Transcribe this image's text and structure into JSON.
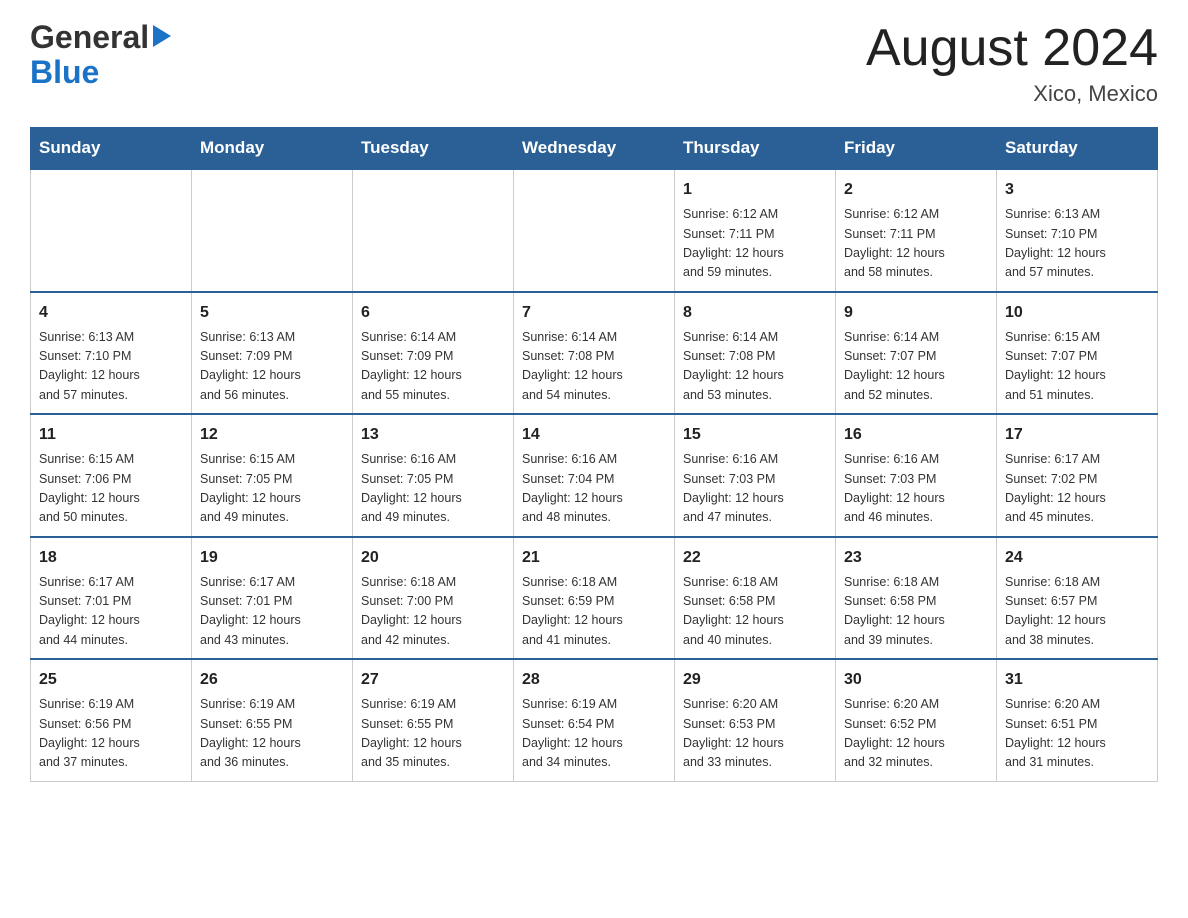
{
  "header": {
    "logo_line1": "General",
    "logo_line2": "Blue",
    "month_title": "August 2024",
    "location": "Xico, Mexico"
  },
  "weekdays": [
    "Sunday",
    "Monday",
    "Tuesday",
    "Wednesday",
    "Thursday",
    "Friday",
    "Saturday"
  ],
  "weeks": [
    {
      "days": [
        {
          "num": "",
          "info": ""
        },
        {
          "num": "",
          "info": ""
        },
        {
          "num": "",
          "info": ""
        },
        {
          "num": "",
          "info": ""
        },
        {
          "num": "1",
          "info": "Sunrise: 6:12 AM\nSunset: 7:11 PM\nDaylight: 12 hours\nand 59 minutes."
        },
        {
          "num": "2",
          "info": "Sunrise: 6:12 AM\nSunset: 7:11 PM\nDaylight: 12 hours\nand 58 minutes."
        },
        {
          "num": "3",
          "info": "Sunrise: 6:13 AM\nSunset: 7:10 PM\nDaylight: 12 hours\nand 57 minutes."
        }
      ]
    },
    {
      "days": [
        {
          "num": "4",
          "info": "Sunrise: 6:13 AM\nSunset: 7:10 PM\nDaylight: 12 hours\nand 57 minutes."
        },
        {
          "num": "5",
          "info": "Sunrise: 6:13 AM\nSunset: 7:09 PM\nDaylight: 12 hours\nand 56 minutes."
        },
        {
          "num": "6",
          "info": "Sunrise: 6:14 AM\nSunset: 7:09 PM\nDaylight: 12 hours\nand 55 minutes."
        },
        {
          "num": "7",
          "info": "Sunrise: 6:14 AM\nSunset: 7:08 PM\nDaylight: 12 hours\nand 54 minutes."
        },
        {
          "num": "8",
          "info": "Sunrise: 6:14 AM\nSunset: 7:08 PM\nDaylight: 12 hours\nand 53 minutes."
        },
        {
          "num": "9",
          "info": "Sunrise: 6:14 AM\nSunset: 7:07 PM\nDaylight: 12 hours\nand 52 minutes."
        },
        {
          "num": "10",
          "info": "Sunrise: 6:15 AM\nSunset: 7:07 PM\nDaylight: 12 hours\nand 51 minutes."
        }
      ]
    },
    {
      "days": [
        {
          "num": "11",
          "info": "Sunrise: 6:15 AM\nSunset: 7:06 PM\nDaylight: 12 hours\nand 50 minutes."
        },
        {
          "num": "12",
          "info": "Sunrise: 6:15 AM\nSunset: 7:05 PM\nDaylight: 12 hours\nand 49 minutes."
        },
        {
          "num": "13",
          "info": "Sunrise: 6:16 AM\nSunset: 7:05 PM\nDaylight: 12 hours\nand 49 minutes."
        },
        {
          "num": "14",
          "info": "Sunrise: 6:16 AM\nSunset: 7:04 PM\nDaylight: 12 hours\nand 48 minutes."
        },
        {
          "num": "15",
          "info": "Sunrise: 6:16 AM\nSunset: 7:03 PM\nDaylight: 12 hours\nand 47 minutes."
        },
        {
          "num": "16",
          "info": "Sunrise: 6:16 AM\nSunset: 7:03 PM\nDaylight: 12 hours\nand 46 minutes."
        },
        {
          "num": "17",
          "info": "Sunrise: 6:17 AM\nSunset: 7:02 PM\nDaylight: 12 hours\nand 45 minutes."
        }
      ]
    },
    {
      "days": [
        {
          "num": "18",
          "info": "Sunrise: 6:17 AM\nSunset: 7:01 PM\nDaylight: 12 hours\nand 44 minutes."
        },
        {
          "num": "19",
          "info": "Sunrise: 6:17 AM\nSunset: 7:01 PM\nDaylight: 12 hours\nand 43 minutes."
        },
        {
          "num": "20",
          "info": "Sunrise: 6:18 AM\nSunset: 7:00 PM\nDaylight: 12 hours\nand 42 minutes."
        },
        {
          "num": "21",
          "info": "Sunrise: 6:18 AM\nSunset: 6:59 PM\nDaylight: 12 hours\nand 41 minutes."
        },
        {
          "num": "22",
          "info": "Sunrise: 6:18 AM\nSunset: 6:58 PM\nDaylight: 12 hours\nand 40 minutes."
        },
        {
          "num": "23",
          "info": "Sunrise: 6:18 AM\nSunset: 6:58 PM\nDaylight: 12 hours\nand 39 minutes."
        },
        {
          "num": "24",
          "info": "Sunrise: 6:18 AM\nSunset: 6:57 PM\nDaylight: 12 hours\nand 38 minutes."
        }
      ]
    },
    {
      "days": [
        {
          "num": "25",
          "info": "Sunrise: 6:19 AM\nSunset: 6:56 PM\nDaylight: 12 hours\nand 37 minutes."
        },
        {
          "num": "26",
          "info": "Sunrise: 6:19 AM\nSunset: 6:55 PM\nDaylight: 12 hours\nand 36 minutes."
        },
        {
          "num": "27",
          "info": "Sunrise: 6:19 AM\nSunset: 6:55 PM\nDaylight: 12 hours\nand 35 minutes."
        },
        {
          "num": "28",
          "info": "Sunrise: 6:19 AM\nSunset: 6:54 PM\nDaylight: 12 hours\nand 34 minutes."
        },
        {
          "num": "29",
          "info": "Sunrise: 6:20 AM\nSunset: 6:53 PM\nDaylight: 12 hours\nand 33 minutes."
        },
        {
          "num": "30",
          "info": "Sunrise: 6:20 AM\nSunset: 6:52 PM\nDaylight: 12 hours\nand 32 minutes."
        },
        {
          "num": "31",
          "info": "Sunrise: 6:20 AM\nSunset: 6:51 PM\nDaylight: 12 hours\nand 31 minutes."
        }
      ]
    }
  ]
}
